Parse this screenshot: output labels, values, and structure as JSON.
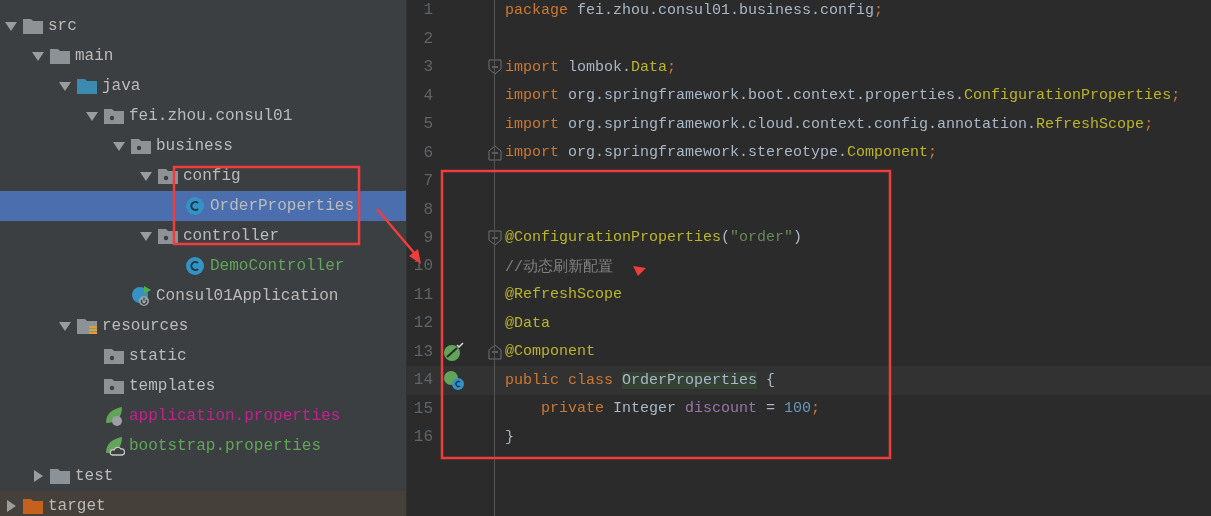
{
  "project_tree": {
    "items": [
      {
        "label": "src",
        "kind": "folder",
        "expanded": true,
        "selected": false,
        "color": "#bbbbbb",
        "children": [
          {
            "label": "main",
            "kind": "folder",
            "expanded": true,
            "selected": false,
            "color": "#bbbbbb",
            "children": [
              {
                "label": "java",
                "kind": "source-folder",
                "expanded": true,
                "selected": false,
                "color": "#bbbbbb",
                "children": [
                  {
                    "label": "fei.zhou.consul01",
                    "kind": "package",
                    "expanded": true,
                    "selected": false,
                    "color": "#bbbbbb",
                    "children": [
                      {
                        "label": "business",
                        "kind": "package",
                        "expanded": true,
                        "selected": false,
                        "color": "#bbbbbb",
                        "children": [
                          {
                            "label": "config",
                            "kind": "package",
                            "expanded": true,
                            "selected": false,
                            "color": "#bbbbbb",
                            "children": [
                              {
                                "label": "OrderProperties",
                                "kind": "class",
                                "selected": true,
                                "color": "#bbbbbb"
                              }
                            ]
                          },
                          {
                            "label": "controller",
                            "kind": "package",
                            "expanded": true,
                            "selected": false,
                            "color": "#bbbbbb",
                            "children": [
                              {
                                "label": "DemoController",
                                "kind": "class",
                                "selected": false,
                                "color": "#62a55a"
                              }
                            ]
                          }
                        ]
                      },
                      {
                        "label": "Consul01Application",
                        "kind": "app-class",
                        "selected": false,
                        "color": "#bbbbbb"
                      }
                    ]
                  }
                ]
              },
              {
                "label": "resources",
                "kind": "resources-folder",
                "expanded": true,
                "selected": false,
                "color": "#bbbbbb",
                "children": [
                  {
                    "label": "static",
                    "kind": "package",
                    "selected": false,
                    "color": "#bbbbbb"
                  },
                  {
                    "label": "templates",
                    "kind": "package",
                    "selected": false,
                    "color": "#bbbbbb"
                  },
                  {
                    "label": "application.properties",
                    "kind": "spring-boot-file",
                    "selected": false,
                    "color": "#c5208e"
                  },
                  {
                    "label": "bootstrap.properties",
                    "kind": "spring-cloud-file",
                    "selected": false,
                    "color": "#62a55a"
                  }
                ]
              }
            ]
          },
          {
            "label": "test",
            "kind": "folder",
            "expanded": false,
            "selected": false,
            "color": "#bbbbbb"
          }
        ]
      },
      {
        "label": "target",
        "kind": "excluded-folder",
        "expanded": false,
        "selected": false,
        "color": "#bbbbbb"
      }
    ]
  },
  "editor": {
    "lines": [
      {
        "number": "1",
        "tokens": [
          {
            "text": "package",
            "kind": "keyword"
          },
          {
            "text": " fei.zhou.consul01.business.config",
            "kind": "plain"
          },
          {
            "text": ";",
            "kind": "keyword"
          }
        ]
      },
      {
        "number": "2"
      },
      {
        "number": "3",
        "fold": {
          "kind": "start"
        },
        "tokens": [
          {
            "text": "import",
            "kind": "keyword"
          },
          {
            "text": " lombok.",
            "kind": "plain"
          },
          {
            "text": "Data",
            "kind": "annotation"
          },
          {
            "text": ";",
            "kind": "keyword"
          }
        ]
      },
      {
        "number": "4",
        "tokens": [
          {
            "text": "import",
            "kind": "keyword"
          },
          {
            "text": " org.springframework.boot.context.properties.",
            "kind": "plain"
          },
          {
            "text": "ConfigurationProperties",
            "kind": "annotation"
          },
          {
            "text": ";",
            "kind": "keyword"
          }
        ]
      },
      {
        "number": "5",
        "tokens": [
          {
            "text": "import",
            "kind": "keyword"
          },
          {
            "text": " org.springframework.cloud.context.config.annotation.",
            "kind": "plain"
          },
          {
            "text": "RefreshScope",
            "kind": "annotation"
          },
          {
            "text": ";",
            "kind": "keyword"
          }
        ]
      },
      {
        "number": "6",
        "fold": {
          "kind": "end"
        },
        "tokens": [
          {
            "text": "import",
            "kind": "keyword"
          },
          {
            "text": " org.springframework.stereotype.",
            "kind": "plain"
          },
          {
            "text": "Component",
            "kind": "annotation"
          },
          {
            "text": ";",
            "kind": "keyword"
          }
        ]
      },
      {
        "number": "7"
      },
      {
        "number": "8"
      },
      {
        "number": "9",
        "fold": {
          "kind": "start"
        },
        "tokens": [
          {
            "text": "@ConfigurationProperties",
            "kind": "annotation"
          },
          {
            "text": "(",
            "kind": "plain"
          },
          {
            "text": "\"order\"",
            "kind": "string"
          },
          {
            "text": ")",
            "kind": "plain"
          }
        ]
      },
      {
        "number": "10",
        "tokens": [
          {
            "text": "//动态刷新配置",
            "kind": "comment"
          }
        ]
      },
      {
        "number": "11",
        "tokens": [
          {
            "text": "@RefreshScope",
            "kind": "annotation"
          }
        ]
      },
      {
        "number": "12",
        "tokens": [
          {
            "text": "@Data",
            "kind": "annotation"
          }
        ]
      },
      {
        "number": "13",
        "fold": {
          "kind": "end"
        },
        "gutter_icon": {
          "kind": "bean"
        },
        "tokens": [
          {
            "text": "@Component",
            "kind": "annotation"
          }
        ]
      },
      {
        "number": "14",
        "gutter_icon": {
          "kind": "bean-class"
        },
        "current": true,
        "tokens": [
          {
            "text": "public class ",
            "kind": "keyword"
          },
          {
            "text": "OrderProperties",
            "kind": "declaration"
          },
          {
            "text": " {",
            "kind": "plain"
          }
        ]
      },
      {
        "number": "15",
        "tokens": [
          {
            "text": "    private",
            "kind": "keyword"
          },
          {
            "text": " Integer ",
            "kind": "plain"
          },
          {
            "text": "discount",
            "kind": "field"
          },
          {
            "text": " = ",
            "kind": "plain"
          },
          {
            "text": "100",
            "kind": "number"
          },
          {
            "text": ";",
            "kind": "keyword"
          }
        ]
      },
      {
        "number": "16",
        "tokens": [
          {
            "text": "}",
            "kind": "plain"
          }
        ]
      }
    ]
  }
}
